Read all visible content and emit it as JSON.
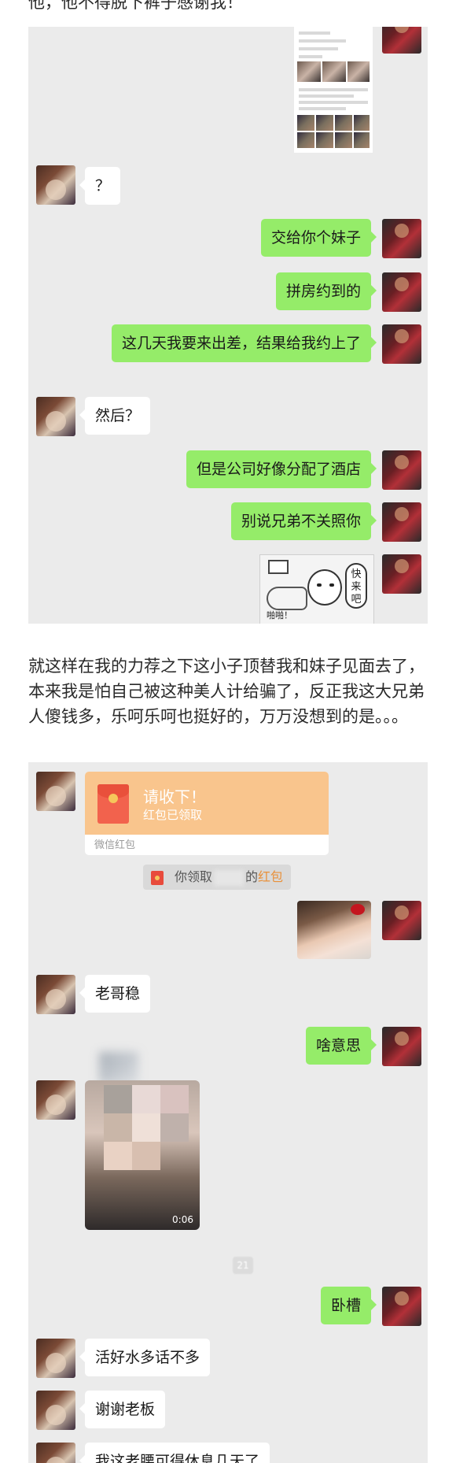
{
  "top_caption": "他，他不得脱下裤子感谢我！",
  "narration": "就这样在我的力荐之下这小子顶替我和妹子见面去了，本来我是怕自己被这种美人计给骗了，反正我这大兄弟人傻钱多，乐呵乐呵也挺好的，万万没想到的是。。。",
  "chat1": {
    "messages": [
      {
        "from": "friend",
        "text": "？"
      },
      {
        "from": "me",
        "text": "交给你个妹子"
      },
      {
        "from": "me",
        "text": "拼房约到的"
      },
      {
        "from": "me",
        "text": "这几天我要来出差，结果给我约上了"
      },
      {
        "from": "friend",
        "text": "然后？"
      },
      {
        "from": "me",
        "text": "但是公司好像分配了酒店"
      },
      {
        "from": "me",
        "text": "别说兄弟不关照你"
      }
    ],
    "sticker": {
      "bubble_text": "快来吧",
      "caption": "啪啪！"
    }
  },
  "chat2": {
    "red_packet": {
      "title": "请收下！",
      "status": "红包已领取",
      "footer": "微信红包"
    },
    "notice": {
      "prefix": "你领取",
      "suffix": "的",
      "highlight": "红包"
    },
    "messages": [
      {
        "from": "friend",
        "text": "老哥稳"
      },
      {
        "from": "me",
        "text": "啥意思"
      },
      {
        "from": "me",
        "text": "卧槽"
      },
      {
        "from": "friend",
        "text": "活好水多话不多"
      },
      {
        "from": "friend",
        "text": "谢谢老板"
      },
      {
        "from": "friend",
        "text": "我这老腰可得休息几天了"
      }
    ],
    "video": {
      "duration": "0:06"
    },
    "time_chip": "21"
  }
}
